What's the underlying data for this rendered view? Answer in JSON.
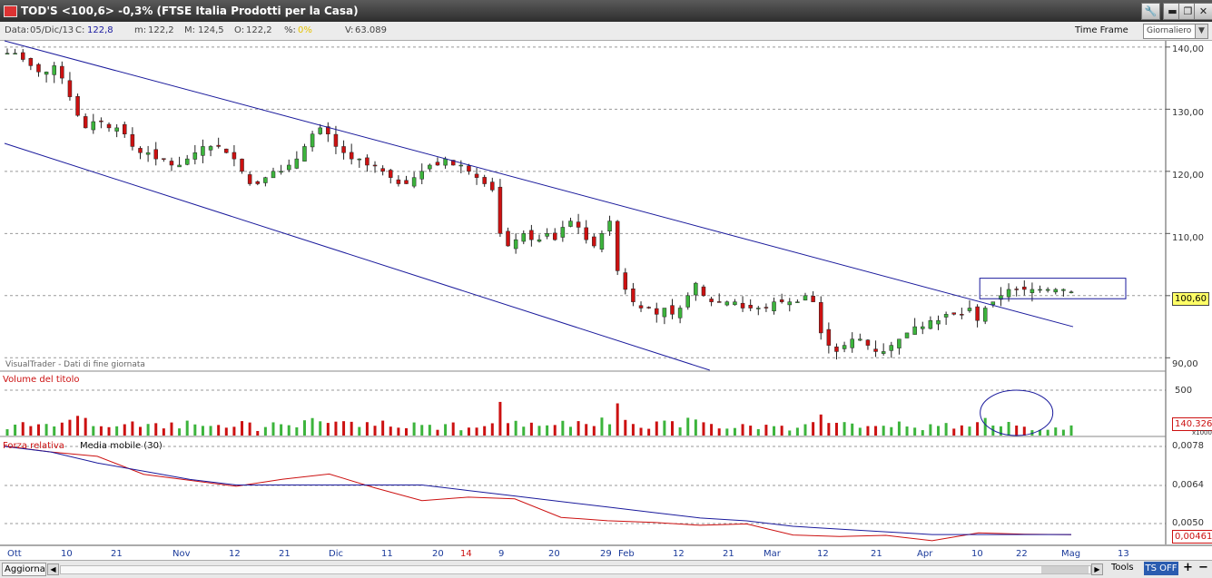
{
  "window": {
    "title": "TOD'S <100,6> -0,3%  (FTSE Italia Prodotti per la Casa)",
    "buttons": {
      "tools": "🔧",
      "minimize": "▬",
      "restore": "❐",
      "close": "✕"
    }
  },
  "infobar": {
    "data_label": "Data:",
    "data_value": "05/Dic/13",
    "c_label": "C:",
    "c_value": "122,8",
    "m_label": "m:",
    "m_value": "122,2",
    "M_label": "M:",
    "M_value": "124,5",
    "o_label": "O:",
    "o_value": "122,2",
    "pct_label": "%:",
    "pct_value": "0%",
    "v_label": "V:",
    "v_value": "63.089",
    "time_frame_label": "Time Frame",
    "time_frame_value": "Giornaliero"
  },
  "price_panel": {
    "y_ticks": [
      "140,00",
      "130,00",
      "120,00",
      "110,00",
      "100,00",
      "90,00"
    ],
    "current_price": "100,60",
    "watermark": "VisualTrader - Dati di fine giornata"
  },
  "volume_panel": {
    "label": "Volume del titolo",
    "y_ticks": [
      "500"
    ],
    "current_value": "140.326",
    "unit": "x1000"
  },
  "rs_panel": {
    "label": "Forza relativa",
    "ma_label": "Media mobile (30)",
    "y_ticks": [
      "0,0078",
      "0,0064",
      "0,0050"
    ],
    "current_value": "0,00461"
  },
  "x_axis": {
    "labels": [
      "Ott",
      "10",
      "21",
      "Nov",
      "12",
      "21",
      "Dic",
      "11",
      "20",
      "14",
      "9",
      "20",
      "29",
      "Feb",
      "12",
      "21",
      "Mar",
      "12",
      "21",
      "Apr",
      "10",
      "22",
      "Mag",
      "13"
    ]
  },
  "bottombar": {
    "aggiorna": "Aggiorna",
    "tools": "Tools",
    "ts_off": "TS OFF",
    "plus": "+",
    "minus": "−"
  },
  "colors": {
    "up": "#3cb43c",
    "down": "#cc1111",
    "trendline": "#1a1a9c",
    "rs_line": "#cc1111",
    "ma_line": "#1a1a9c",
    "price_tag": "#ffff66"
  },
  "chart_data": [
    {
      "type": "candlestick",
      "title": "TOD'S <100,6> -0,3%  (FTSE Italia Prodotti per la Casa)",
      "x_labels": [
        "Ott",
        "10",
        "21",
        "Nov",
        "12",
        "21",
        "Dic",
        "11",
        "20",
        "14",
        "9",
        "20",
        "29",
        "Feb",
        "12",
        "21",
        "Mar",
        "12",
        "21",
        "Apr",
        "10",
        "22",
        "Mag",
        "13"
      ],
      "ylim": [
        88,
        141
      ],
      "y_ticks": [
        140,
        130,
        120,
        110,
        100,
        90
      ],
      "grid": true,
      "close_approx": [
        139,
        139,
        138,
        137,
        136,
        136,
        137,
        135,
        132,
        129,
        127,
        128,
        128,
        127,
        127,
        126,
        124,
        123,
        123,
        122,
        122,
        121,
        121,
        122,
        123,
        124,
        124,
        124,
        123,
        122,
        120,
        118,
        118,
        119,
        120,
        120,
        121,
        122,
        124,
        126,
        127,
        126,
        124,
        123,
        122,
        122,
        121,
        121,
        120,
        119,
        118,
        118,
        119,
        120,
        121,
        121,
        122,
        121,
        121,
        120,
        119,
        118,
        117,
        110,
        108,
        109,
        110,
        109,
        109,
        110,
        109,
        111,
        112,
        111,
        109,
        108,
        110,
        112,
        104,
        101,
        99,
        98,
        98,
        97,
        98,
        97,
        98,
        100,
        102,
        100,
        99,
        99,
        99,
        99,
        98,
        98,
        98,
        98,
        99,
        99,
        99,
        99,
        100,
        99,
        94,
        92,
        91,
        92,
        93,
        93,
        92,
        91,
        91,
        92,
        93,
        94,
        95,
        95,
        96,
        96,
        97,
        97,
        97,
        98,
        96,
        98,
        99,
        100,
        101,
        101,
        101,
        101,
        101,
        101,
        101,
        101,
        100.6
      ],
      "trend_channel": {
        "upper": [
          [
            0,
            141
          ],
          [
            1,
            95
          ]
        ],
        "lower": [
          [
            0,
            124.5
          ],
          [
            0.66,
            88
          ]
        ]
      },
      "highlight_box": {
        "from_index": 125,
        "to_index": 136,
        "low": 99.5,
        "high": 102.8
      }
    },
    {
      "type": "bar",
      "title": "Volume del titolo",
      "unit": "x1000",
      "y_ticks": [
        500
      ],
      "last_value": "140.326"
    },
    {
      "type": "line",
      "title": "Forza relativa",
      "series": [
        {
          "name": "Forza relativa",
          "values": [
            0.0078,
            0.0076,
            0.0074,
            0.0068,
            0.0066,
            0.0064,
            0.0066,
            0.0068,
            0.0063,
            0.0058,
            0.006,
            0.0059,
            0.0052,
            0.0051,
            0.005,
            0.0049,
            0.005,
            0.0046,
            0.0045,
            0.0046,
            0.0044,
            0.0047,
            0.0046,
            0.00461
          ]
        },
        {
          "name": "Media mobile (30)",
          "values": [
            0.0078,
            0.0076,
            0.0072,
            0.0069,
            0.0066,
            0.0064,
            0.0064,
            0.0064,
            0.0064,
            0.0064,
            0.0062,
            0.006,
            0.0058,
            0.0056,
            0.0054,
            0.0052,
            0.0051,
            0.0049,
            0.0048,
            0.0047,
            0.0046,
            0.0046,
            0.0046,
            0.0046
          ]
        }
      ],
      "y_ticks": [
        0.0078,
        0.0064,
        0.005
      ],
      "last_value": "0,00461"
    }
  ]
}
